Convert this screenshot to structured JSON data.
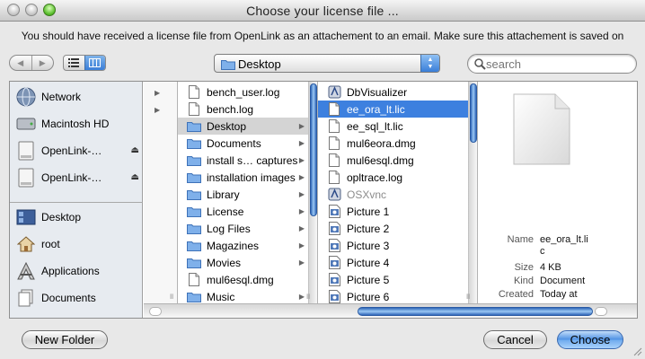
{
  "window": {
    "title": "Choose your license file ...",
    "message": "You should have received a license file from OpenLink as an attachement to an email. Make sure this attachement is saved on"
  },
  "toolbar": {
    "nav_back": "◀",
    "nav_forward": "▶",
    "location": "Desktop",
    "search_placeholder": "search"
  },
  "sidebar": {
    "devices": [
      {
        "label": "Network",
        "icon": "network-globe-icon"
      },
      {
        "label": "Macintosh HD",
        "icon": "hard-drive-icon"
      },
      {
        "label": "OpenLink-…",
        "icon": "disk-image-icon",
        "ejectable": true
      },
      {
        "label": "OpenLink-…",
        "icon": "disk-image-icon",
        "ejectable": true
      }
    ],
    "places": [
      {
        "label": "Desktop",
        "icon": "desktop-folder-icon"
      },
      {
        "label": "root",
        "icon": "home-icon"
      },
      {
        "label": "Applications",
        "icon": "applications-icon"
      },
      {
        "label": "Documents",
        "icon": "documents-icon"
      }
    ]
  },
  "column2": [
    {
      "name": "bench_user.log",
      "kind": "file"
    },
    {
      "name": "bench.log",
      "kind": "file"
    },
    {
      "name": "Desktop",
      "kind": "folder",
      "selected": true
    },
    {
      "name": "Documents",
      "kind": "folder"
    },
    {
      "name": "install s… captures",
      "kind": "folder"
    },
    {
      "name": "installation images",
      "kind": "folder"
    },
    {
      "name": "Library",
      "kind": "folder"
    },
    {
      "name": "License",
      "kind": "folder"
    },
    {
      "name": "Log Files",
      "kind": "folder"
    },
    {
      "name": "Magazines",
      "kind": "folder"
    },
    {
      "name": "Movies",
      "kind": "folder"
    },
    {
      "name": "mul6esql.dmg",
      "kind": "file"
    },
    {
      "name": "Music",
      "kind": "folder"
    }
  ],
  "column3": [
    {
      "name": "DbVisualizer",
      "kind": "app"
    },
    {
      "name": "ee_ora_lt.lic",
      "kind": "file",
      "selected": true
    },
    {
      "name": "ee_sql_lt.lic",
      "kind": "file"
    },
    {
      "name": "mul6eora.dmg",
      "kind": "file"
    },
    {
      "name": "mul6esql.dmg",
      "kind": "file"
    },
    {
      "name": "opltrace.log",
      "kind": "file"
    },
    {
      "name": "OSXvnc",
      "kind": "app",
      "dim": true
    },
    {
      "name": "Picture 1",
      "kind": "picture"
    },
    {
      "name": "Picture 2",
      "kind": "picture"
    },
    {
      "name": "Picture 3",
      "kind": "picture"
    },
    {
      "name": "Picture 4",
      "kind": "picture"
    },
    {
      "name": "Picture 5",
      "kind": "picture"
    },
    {
      "name": "Picture 6",
      "kind": "picture"
    }
  ],
  "preview": {
    "name_label": "Name",
    "name_line1": "ee_ora_lt.li",
    "name_line2": "c",
    "size_label": "Size",
    "size_value": "4 KB",
    "kind_label": "Kind",
    "kind_value": "Document",
    "created_label": "Created",
    "created_value": "Today at"
  },
  "buttons": {
    "new_folder": "New Folder",
    "cancel": "Cancel",
    "choose": "Choose"
  },
  "colors": {
    "selection_blue": "#3d80df",
    "sidebar_bg": "#e7ebf0",
    "folder_blue": "#6aa3e6"
  }
}
